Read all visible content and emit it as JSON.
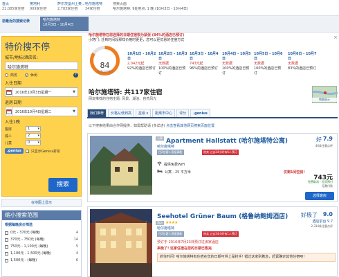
{
  "breadcrumb": {
    "row1": [
      "首页",
      "奥地利",
      "萨尔茨堡州上奥...",
      "哈尔施塔特",
      "搜索页面"
    ],
    "row2": [
      "21,085家住宿",
      "909家住宿",
      "2,783家住宿",
      "34家住宿",
      "哈尔施塔特: 9处地点, 1 晚 (10月3日 - 10月4日)"
    ]
  },
  "recent": {
    "label": "您最近的搜索记录",
    "tab_line1": "哈尔施塔特",
    "tab_line2": "10月3日 - 10月4日"
  },
  "search": {
    "title": "特价搜不停",
    "dest_label": "城市/地标/酒店名:",
    "dest_value": "哈尔施塔特",
    "radio_leisure": "商务",
    "radio_business": "休闲",
    "checkin_label": "入住日期",
    "checkin_value": "2016年10月3日星期一",
    "checkout_label": "退房日期",
    "checkout_value": "2016年10月4日星期二",
    "nights": "入住1晚",
    "rooms_label": "客房",
    "rooms_value": "1",
    "adults_label": "成人",
    "adults_value": "2",
    "kids_label": "儿童",
    "kids_value": "0",
    "genius_badge": ".genius",
    "genius_text": "只显示Genius折扣",
    "button": "搜索"
  },
  "map_link": "在地图上显示",
  "filters": {
    "header": "缩小搜索范围",
    "price_title": "根据每晚房价筛选",
    "rows": [
      {
        "label": "0元 - 370元 (每晚)",
        "count": "4"
      },
      {
        "label": "370元 - 750元 (每晚)",
        "count": "14"
      },
      {
        "label": "750元 - 1,100元 (每晚)",
        "count": "5"
      },
      {
        "label": "1,100元 - 1,500元 (每晚)",
        "count": "4"
      },
      {
        "label": "1,500元 - (每晚)",
        "count": "6"
      }
    ]
  },
  "notice": {
    "line1": "哈尔施塔特在您选择的日期住宿很为紧张 (84%的酒店已预订)",
    "line2": "小窍门: 迁到时间段那样价格时更更，您可以更优惠的住宿方式"
  },
  "gauge": {
    "value": "84",
    "percent": 84,
    "sublabel": "的酒店已预订"
  },
  "nights_strip": [
    {
      "date": "10月1日 - 10月2日",
      "price": "2,042元起",
      "pct": "92%的酒店已预订"
    },
    {
      "date": "10月2日 - 10月3日",
      "price": "无数据",
      "pct": "100%的酒店已预订"
    },
    {
      "date": "10月3日 - 10月4日",
      "price": "743元起",
      "pct": "96%的酒店已预订"
    },
    {
      "date": "10月4日 - 10月5日",
      "price": "无数据",
      "pct": "100%的酒店已预订"
    },
    {
      "date": "10月5日 - 10月6日",
      "price": "无数据",
      "pct": "100%的酒店已预订"
    },
    {
      "date": "10月6日 - 10月7日",
      "price": "无数据",
      "pct": "83%的酒店已预订"
    }
  ],
  "heading": {
    "title": "哈尔施塔特: 共117家住宿",
    "subtitle": "网友推荐的住宿主题: 风景、湖泊、自然风光"
  },
  "map_thumb": "地图显示",
  "sort_tabs": [
    "我们推荐",
    "价格从低到高",
    "星级 ▾",
    "距离市中心",
    "评分",
    ".genius"
  ],
  "small_note": {
    "text": "以下搜索结果由合作网提供，如需帮助请 (多详述)",
    "link": "点击查看其他网页搜索页面位置"
  },
  "hotels": [
    {
      "name": "Apartment Hallstatt (哈尔施塔特公寓)",
      "location": "哈尔施塔特",
      "type": "公寓",
      "tag1": "住2位客人直接满能",
      "tag2": "热卖 过去24小时有6人预订",
      "score_word": "好",
      "score": "7.9",
      "reviews": "46条住客点评",
      "feature1": "提供免费WiFi",
      "feature2": "公寓 - 25 平方米",
      "room_tag": "仅剩1间空房!",
      "price": "743元",
      "price_sub1": "免费取消 - 无须预付",
      "price_sub2": "无需付款",
      "button": "选择客房"
    },
    {
      "name": "Seehotel Grüner Baum (格鲁纳鲍姆酒店)",
      "location": "哈尔施塔特",
      "type": "酒店",
      "tag1": "住2位客人直接满能",
      "tag2": "热卖 过去24小时有1人预订",
      "score_word": "好极了",
      "score": "9.0",
      "score_sub": "酒店前台 9.7",
      "reviews": "2,334条住客点评",
      "feature1": "预订于 2016年7月23日预订过该家酒店",
      "feature2": "来晚了! 这家住宿在您的日期已售完",
      "feature3": "抓住时间! 哈尔施塔特有住宿在您的日期可供上是抢手! 错过这家别着急，赶紧确定其他住宿吧!"
    }
  ]
}
